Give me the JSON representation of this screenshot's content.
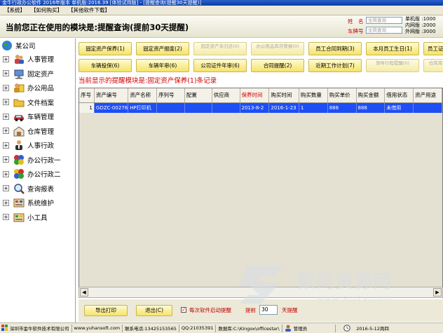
{
  "window": {
    "title": "金牛行政办公软件 2016年版本 单机版:2016.39 [体验试用版] - [提醒查询(提醒30天提醒)]"
  },
  "menu": [
    "【系统】",
    "【如何购买】",
    "【其他软件下载】"
  ],
  "header": {
    "module_prefix": "当前您正在使用的模块是:",
    "module_name": "提醒查询(提前30天提醒)",
    "name_label": "姓　名",
    "name_placeholder": "全简查询",
    "plate_label": "车牌号",
    "plate_placeholder": "全简查询",
    "stats": [
      {
        "label": "单机版 :",
        "value": "1000"
      },
      {
        "label": "内网版 :",
        "value": "2000"
      },
      {
        "label": "外网版 :",
        "value": "3000"
      }
    ]
  },
  "sidebar": {
    "root": "某公司",
    "items": [
      "人事管理",
      "固定资产",
      "办公用品",
      "文件档案",
      "车辆管理",
      "仓库管理",
      "人事行政",
      "办公行政一",
      "办公行政二",
      "查询报表",
      "系统维护",
      "小工具"
    ]
  },
  "buttons_row1": [
    {
      "label": "固定资产保养(1)",
      "disabled": false
    },
    {
      "label": "固定资产报废(2)",
      "disabled": false
    },
    {
      "label": "固定资产未归还(0)",
      "disabled": true
    },
    {
      "label": "办公用品库存警报(0)",
      "disabled": true
    },
    {
      "label": "员工合同到期(3)",
      "disabled": false
    },
    {
      "label": "本月员工生日(1)",
      "disabled": false
    },
    {
      "label": "员工证件",
      "disabled": false
    }
  ],
  "buttons_row2": [
    {
      "label": "车辆投保(6)",
      "disabled": false
    },
    {
      "label": "车辆年审(6)",
      "disabled": false
    },
    {
      "label": "公司证件年审(6)",
      "disabled": false
    },
    {
      "label": "合同提醒(2)",
      "disabled": false
    },
    {
      "label": "近期工作计划(7)",
      "disabled": false
    },
    {
      "label": "领导行程提醒(0)",
      "disabled": true
    },
    {
      "label": "仓库库存",
      "disabled": true
    }
  ],
  "notice": "当前显示的提醒模块是:固定资产保养(1)条记录",
  "table": {
    "columns": [
      "序号",
      "资产编号",
      "资产名称",
      "序列号",
      "配置",
      "供应商",
      "保养时间",
      "购买时间",
      "购买数量",
      "购买单价",
      "购买金额",
      "借用状态",
      "资产用途"
    ],
    "highlight_column": "保养时间",
    "rows": [
      [
        "1",
        "GDZC-00276",
        "HP打印机",
        "",
        "",
        "",
        "2013-8-2",
        "2016-1-23",
        "1",
        "888",
        "888",
        "未借用",
        ""
      ]
    ]
  },
  "bottom": {
    "export_label": "导出打印",
    "exit_label": "退出(C)",
    "auto_remind_label": "每次软件启动提醒",
    "advance_label": "提前",
    "advance_days": "30",
    "days_label": "天提醒"
  },
  "watermark": {
    "text": "数码资源网",
    "url": "www.smzy.com"
  },
  "statusbar": {
    "company": "深圳市金牛软件技术有限公司",
    "website": "www.yuhansoft.com",
    "phone": "联系电话:13425153565",
    "qq": "QQ:21035391",
    "db": "数据库:C:\\Kingox\\officestar\\",
    "user": "管理员",
    "date": "2016-5-12周四"
  },
  "colors": {
    "selected_row": "#1d4ff5",
    "alert_red": "#d00000",
    "button_yellow": "#f5e36a"
  }
}
